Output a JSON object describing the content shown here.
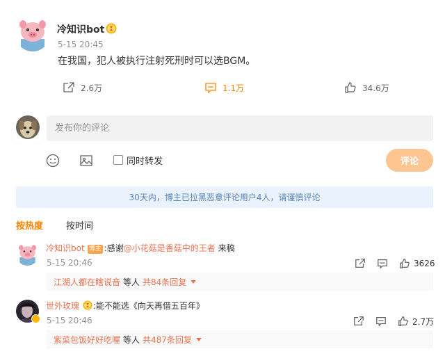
{
  "post": {
    "author": "冷知识bot",
    "badge_icon": "hourglass-badge-icon",
    "time": "5-15 20:45",
    "text": "在我国，犯人被执行注射死刑时可以选BGM。",
    "actions": {
      "repost": {
        "icon": "repost-icon",
        "count": "2.6万"
      },
      "comment": {
        "icon": "comment-icon",
        "count": "1.1万"
      },
      "like": {
        "icon": "thumbs-up-icon",
        "count": "34.6万"
      }
    }
  },
  "composer": {
    "placeholder": "发布你的评论",
    "repost_label": "同时转发",
    "submit_label": "评论",
    "tools": [
      "emoji-icon",
      "image-icon"
    ]
  },
  "notice": "30天内，博主已拉黑恶意评论用户4人，请谨慎评论",
  "sort_tabs": [
    {
      "label": "按热度",
      "active": true
    },
    {
      "label": "按时间",
      "active": false
    }
  ],
  "comments": [
    {
      "user": "冷知识bot",
      "blogger_tag": "博主",
      "text_before": ":感谢",
      "mention": "@小花菇是香菇中的王者",
      "text_after": " 来稿",
      "time": "5-15 20:46",
      "likes": "3626",
      "reply_user": "江湖人都在瞎说音",
      "reply_mid": "等人",
      "reply_count": "共84条回复"
    },
    {
      "user": "世外玫瑰",
      "text": ":能不能选《向天再借五百年》",
      "time": "5-15 20:46",
      "likes": "2.7万",
      "reply_user": "紫菜包饭好好吃喔",
      "reply_mid": "等人",
      "reply_count": "共487条回复"
    }
  ],
  "colors": {
    "accent": "#ff8200",
    "link": "#eb7350",
    "submit_disabled": "#fdc592",
    "notice_bg": "#eaf3fd",
    "notice_text": "#5a84b8"
  }
}
